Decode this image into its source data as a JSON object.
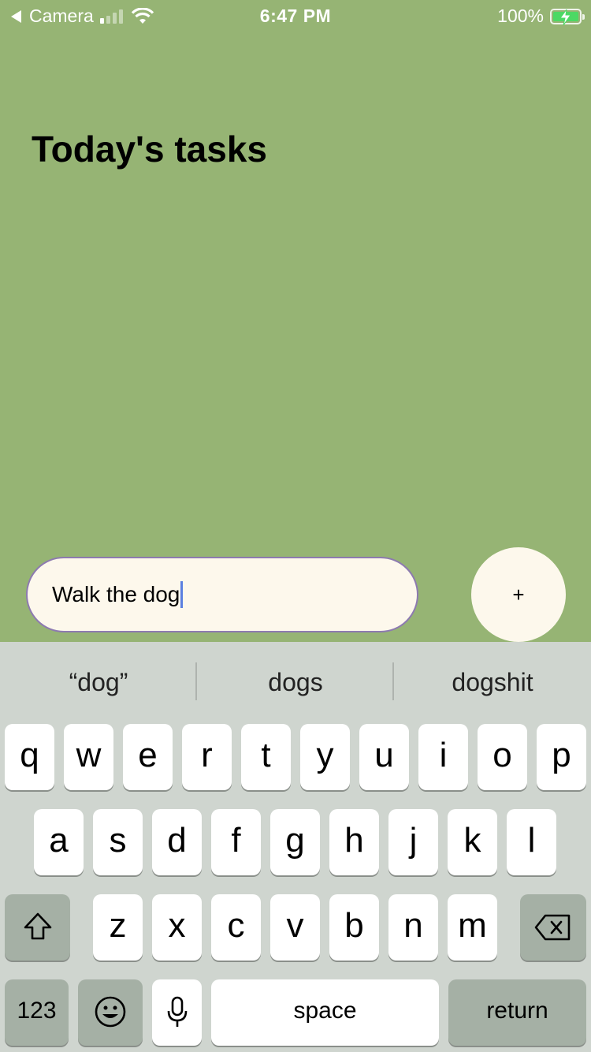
{
  "status_bar": {
    "back_label": "Camera",
    "time": "6:47 PM",
    "battery": "100%",
    "signal_bars_active": 1
  },
  "page": {
    "title": "Today's tasks"
  },
  "task_form": {
    "input_value": "Walk the dog",
    "add_label": "+"
  },
  "keyboard": {
    "suggestions": [
      "“dog”",
      "dogs",
      "dogshit"
    ],
    "row1": [
      "q",
      "w",
      "e",
      "r",
      "t",
      "y",
      "u",
      "i",
      "o",
      "p"
    ],
    "row2": [
      "a",
      "s",
      "d",
      "f",
      "g",
      "h",
      "j",
      "k",
      "l"
    ],
    "row3": [
      "z",
      "x",
      "c",
      "v",
      "b",
      "n",
      "m"
    ],
    "numbers_label": "123",
    "space_label": "space",
    "return_label": "return"
  },
  "colors": {
    "background": "#96b474",
    "input_fill": "#fdf8ec",
    "input_border": "#8d7ab0",
    "keyboard_bg": "#cfd5cf"
  },
  "icons": [
    "back-arrow-icon",
    "signal-icon",
    "wifi-icon",
    "battery-icon",
    "shift-icon",
    "backspace-icon",
    "emoji-icon",
    "microphone-icon"
  ]
}
